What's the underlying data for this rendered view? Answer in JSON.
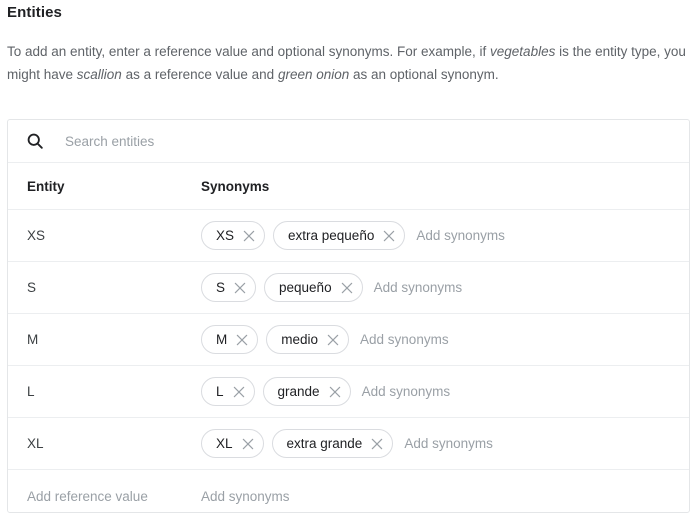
{
  "heading": {
    "title": "Entities",
    "description_parts": [
      {
        "text": "To add an entity, enter a reference value and optional synonyms. For example, if ",
        "italic": false
      },
      {
        "text": "vegetables",
        "italic": true
      },
      {
        "text": " is the entity type, you might have ",
        "italic": false
      },
      {
        "text": "scallion",
        "italic": true
      },
      {
        "text": " as a reference value and ",
        "italic": false
      },
      {
        "text": "green onion",
        "italic": true
      },
      {
        "text": " as an optional synonym.",
        "italic": false
      }
    ]
  },
  "search": {
    "icon": "search-icon",
    "placeholder": "Search entities",
    "value": ""
  },
  "table": {
    "columns": [
      {
        "key": "entity",
        "label": "Entity"
      },
      {
        "key": "synonyms",
        "label": "Synonyms"
      }
    ],
    "rows": [
      {
        "entity": "XS",
        "chips": [
          "XS",
          "extra pequeño"
        ],
        "add_synonyms_placeholder": "Add synonyms"
      },
      {
        "entity": "S",
        "chips": [
          "S",
          "pequeño"
        ],
        "add_synonyms_placeholder": "Add synonyms"
      },
      {
        "entity": "M",
        "chips": [
          "M",
          "medio"
        ],
        "add_synonyms_placeholder": "Add synonyms"
      },
      {
        "entity": "L",
        "chips": [
          "L",
          "grande"
        ],
        "add_synonyms_placeholder": "Add synonyms"
      },
      {
        "entity": "XL",
        "chips": [
          "XL",
          "extra grande"
        ],
        "add_synonyms_placeholder": "Add synonyms"
      }
    ],
    "add_row": {
      "reference_placeholder": "Add reference value",
      "synonyms_placeholder": "Add synonyms"
    },
    "chip_remove_icon": "close-icon"
  },
  "colors": {
    "text_primary": "#202124",
    "text_secondary": "#3c4043",
    "text_muted": "#9aa0a6",
    "border": "#e4e6e8",
    "row_divider": "#eceef0",
    "chip_border": "#dadce0",
    "background": "#ffffff"
  }
}
